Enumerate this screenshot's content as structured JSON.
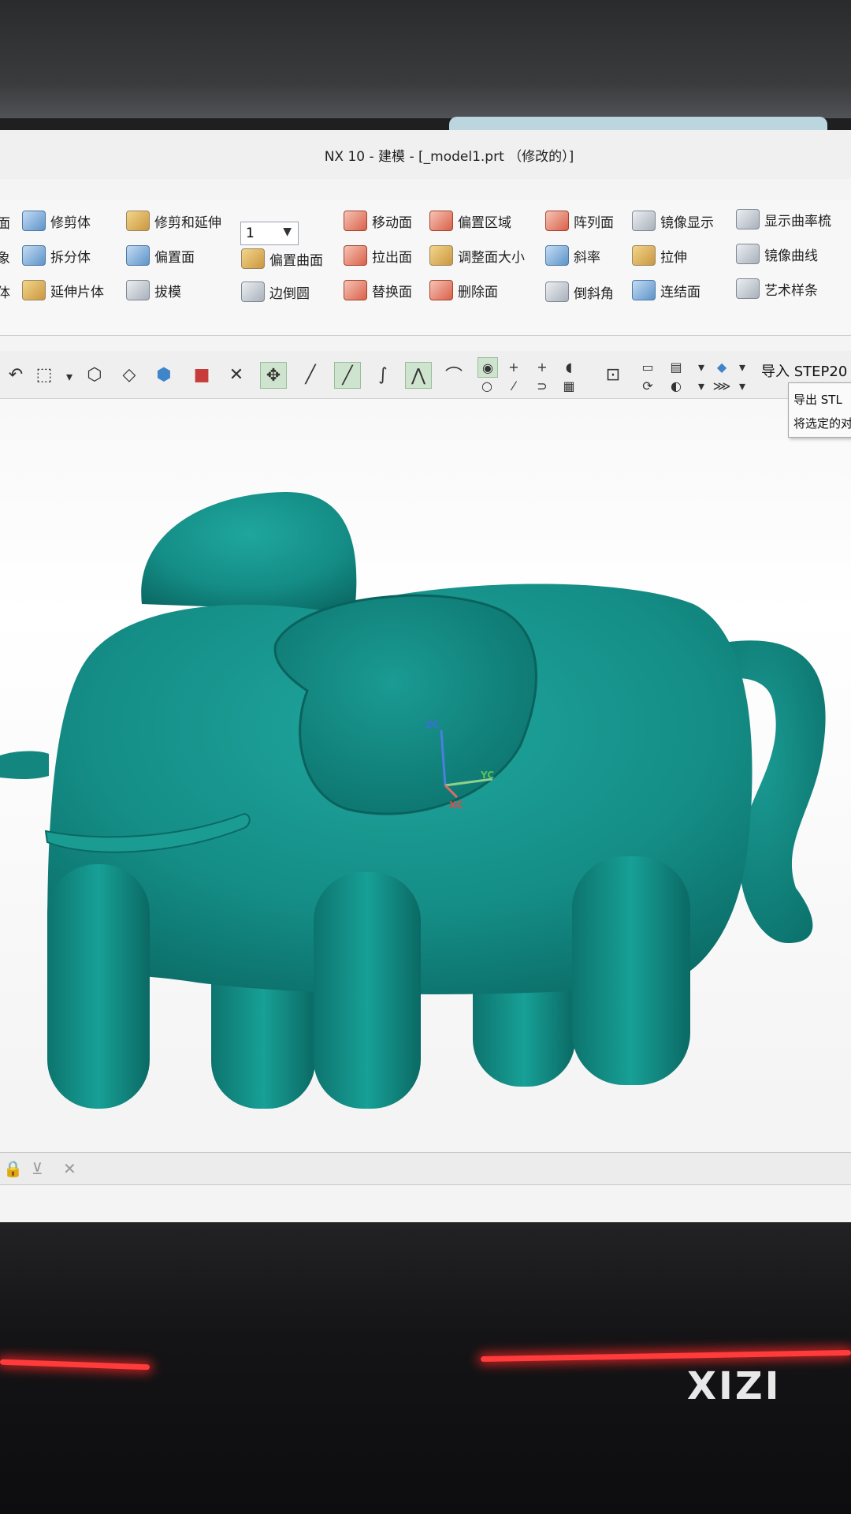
{
  "window": {
    "title": "NX 10 - 建模 - [_model1.prt （修改的）]"
  },
  "ribbon": {
    "col1": [
      "面",
      "象",
      "体"
    ],
    "col2": [
      "修剪体",
      "拆分体",
      "延伸片体"
    ],
    "col3": [
      "修剪和延伸",
      "偏置面",
      "拔模"
    ],
    "col4": [
      "偏置曲面",
      "边倒圆"
    ],
    "select_value": "1",
    "col5": [
      "移动面",
      "拉出面",
      "替换面"
    ],
    "col6": [
      "偏置区域",
      "调整面大小",
      "删除面"
    ],
    "col7": [
      "阵列面",
      "斜率",
      "倒斜角"
    ],
    "col8": [
      "镜像显示",
      "拉伸",
      "连结面"
    ],
    "col9": [
      "显示曲率梳",
      "镜像曲线",
      "艺术样条"
    ]
  },
  "toolbar": {
    "import_label": "导入 STEP20"
  },
  "tooltip": {
    "line1": "导出 STL",
    "line2": "将选定的对"
  },
  "triad": {
    "z": "ZC",
    "y": "YC",
    "x": "XC"
  },
  "model": {
    "color": "#14918a",
    "name": "elephant-model"
  },
  "photo": {
    "watermark": "XIZI"
  }
}
